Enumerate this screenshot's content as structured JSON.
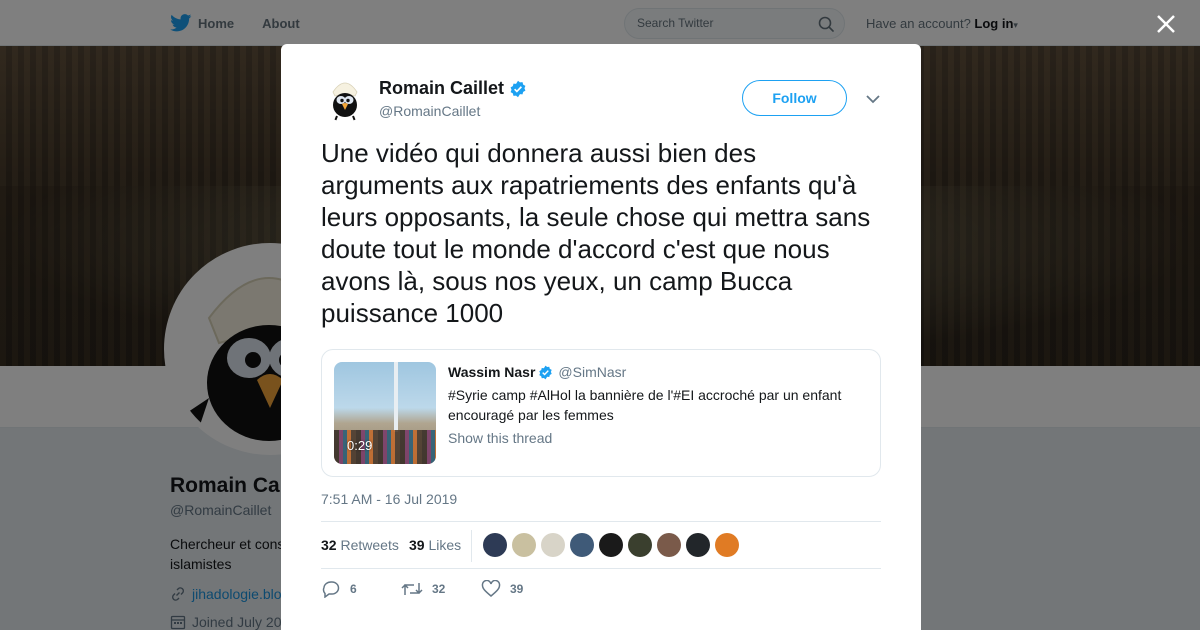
{
  "nav": {
    "home_label": "Home",
    "about_label": "About",
    "search_placeholder": "Search Twitter",
    "have_account": "Have an account?",
    "login_label": "Log in"
  },
  "background_profile": {
    "name": "Romain Ca",
    "handle": "@RomainCaillet",
    "bio": "Chercheur et cons\nislamistes",
    "link": "jihadologie.blo",
    "joined": "Joined July 20"
  },
  "tweet": {
    "author_name": "Romain Caillet",
    "author_handle": "@RomainCaillet",
    "follow_label": "Follow",
    "text": "Une vidéo qui donnera aussi bien des arguments aux rapatriements des enfants qu'à leurs opposants, la seule chose qui mettra sans doute tout le monde d'accord c'est que nous avons là, sous nos yeux, un camp Bucca puissance 1000",
    "timestamp": "7:51 AM - 16 Jul 2019",
    "retweets_count": "32",
    "retweets_label": "Retweets",
    "likes_count": "39",
    "likes_label": "Likes",
    "reply_count": "6",
    "retweet_action_count": "32",
    "like_action_count": "39"
  },
  "quoted": {
    "name": "Wassim Nasr",
    "handle": "@SimNasr",
    "text": "#Syrie camp #AlHol la bannière de l'#EI accroché par un enfant encouragé par les femmes",
    "show_thread": "Show this thread",
    "video_duration": "0:29"
  },
  "colors": {
    "accent": "#1da1f2",
    "verified": "#1da1f2",
    "text_primary": "#14171a",
    "text_secondary": "#657786"
  },
  "liker_avatars": [
    "#2d3a55",
    "#c9c0a0",
    "#d8d4c8",
    "#3f5a78",
    "#1a1a1a",
    "#3a3f2e",
    "#7a5a4a",
    "#22262a",
    "#e07b24"
  ]
}
